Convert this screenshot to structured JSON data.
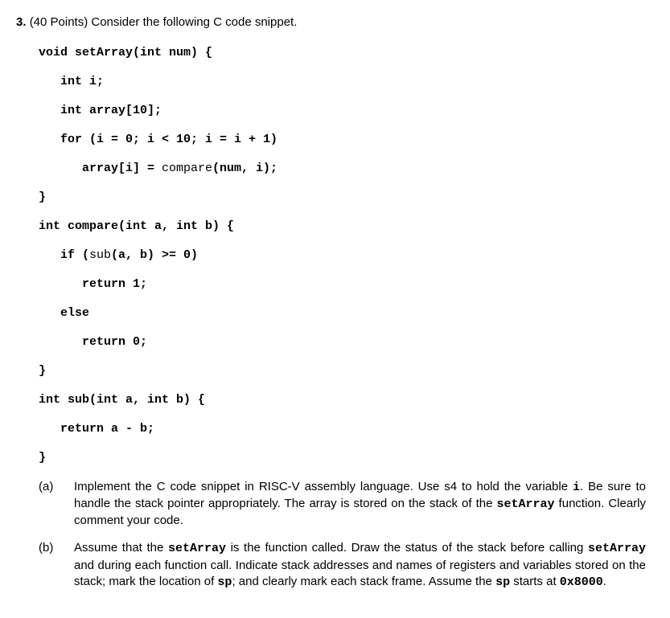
{
  "question": {
    "number": "3.",
    "points": "(40 Points) Consider the following C code snippet."
  },
  "code": {
    "l1": "void setArray(int num) {",
    "l2": "   int i;",
    "l3": "   int array[10];",
    "l4": "   for (i = 0; i < 10; i = i + 1)",
    "l5_pre": "      array[i] = ",
    "l5_mid": "compare",
    "l5_post": "(num, i);",
    "l6": "}",
    "l7": "int compare(int a, int b) {",
    "l8_pre": "   if (",
    "l8_mid": "sub",
    "l8_post": "(a, b) >= 0)",
    "l9": "      return 1;",
    "l10": "   else",
    "l11": "      return 0;",
    "l12": "}",
    "l13": "int sub(int a, int b) {",
    "l14": "   return a - b;",
    "l15": "}"
  },
  "parts": {
    "a": {
      "label": "(a)",
      "t1": "Implement the C code snippet in RISC-V assembly language. Use s4 to hold the variable ",
      "m1": "i",
      "t2": ". Be sure to handle the stack pointer appropriately. The array is stored on the stack of the ",
      "m2": "setArray",
      "t3": " function. Clearly comment your code."
    },
    "b": {
      "label": "(b)",
      "t1": "Assume that the ",
      "m1": "setArray",
      "t2": " is the function called. Draw the status of the stack before calling ",
      "m2": "setArray",
      "t3": " and during each function call. Indicate stack addresses and names of registers and variables stored on the stack; mark the location of ",
      "m3": "sp",
      "t4": "; and clearly mark each stack frame. Assume the ",
      "m4": "sp",
      "t5": " starts at ",
      "m5": "0x8000",
      "t6": "."
    }
  }
}
